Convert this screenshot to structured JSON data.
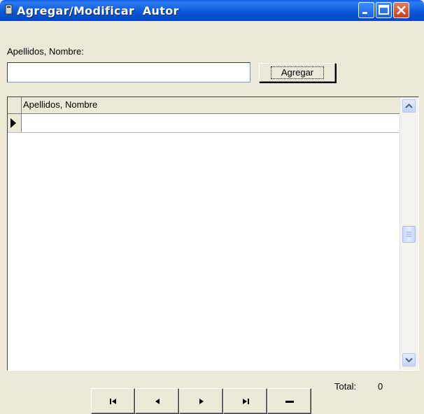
{
  "window": {
    "title": "Agregar/Modificar  Autor",
    "controls": [
      "minimize-icon",
      "maximize-icon",
      "close-icon"
    ]
  },
  "form": {
    "label": "Apellidos, Nombre:",
    "input_value": "",
    "add_button_label": "Agregar"
  },
  "grid": {
    "columns": [
      "Apellidos, Nombre"
    ],
    "rows": [
      ""
    ]
  },
  "footer": {
    "total_label": "Total:",
    "total_value": "0"
  },
  "navigation": {
    "buttons": [
      "first-record-icon",
      "previous-record-icon",
      "next-record-icon",
      "last-record-icon",
      "delete-record-icon"
    ]
  },
  "colors": {
    "titlebar": "#0a58d8",
    "window_bg": "#ece9d8",
    "close_button": "#c9401e"
  }
}
